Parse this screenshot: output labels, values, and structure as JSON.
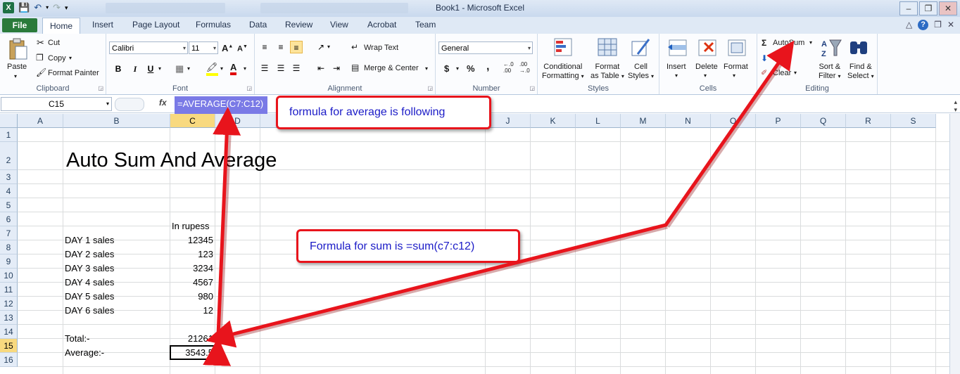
{
  "window": {
    "title": "Book1  -  Microsoft Excel"
  },
  "tabs": {
    "file": "File",
    "items": [
      "Home",
      "Insert",
      "Page Layout",
      "Formulas",
      "Data",
      "Review",
      "View",
      "Acrobat",
      "Team"
    ]
  },
  "ribbon": {
    "clipboard": {
      "label": "Clipboard",
      "paste": "Paste",
      "cut": "Cut",
      "copy": "Copy",
      "format_painter": "Format Painter"
    },
    "font": {
      "label": "Font",
      "font_name": "Calibri",
      "font_size": "11",
      "bold": "B",
      "italic": "I",
      "underline": "U"
    },
    "alignment": {
      "label": "Alignment",
      "wrap_text": "Wrap Text",
      "merge_center": "Merge & Center"
    },
    "number": {
      "label": "Number",
      "format": "General",
      "currency": "$",
      "percent": "%",
      "comma": ","
    },
    "styles": {
      "label": "Styles",
      "conditional_formatting": "Conditional",
      "conditional_formatting_2": "Formatting",
      "format_as_table": "Format",
      "format_as_table_2": "as Table",
      "cell_styles": "Cell",
      "cell_styles_2": "Styles"
    },
    "cells": {
      "label": "Cells",
      "insert": "Insert",
      "delete": "Delete",
      "format": "Format"
    },
    "editing": {
      "label": "Editing",
      "autosum": "AutoSum",
      "fill": "Fi",
      "clear": "Clear",
      "sort_filter": "Sort &",
      "sort_filter_2": "Filter",
      "find_select": "Find &",
      "find_select_2": "Select"
    }
  },
  "formula_bar": {
    "name_box": "C15",
    "fx": "fx",
    "formula": "=AVERAGE(C7:C12)"
  },
  "sheet": {
    "columns": [
      "A",
      "B",
      "C",
      "D",
      "J",
      "K",
      "L",
      "M",
      "N",
      "O",
      "P",
      "Q",
      "R",
      "S"
    ],
    "rows": [
      "1",
      "2",
      "3",
      "4",
      "5",
      "6",
      "7",
      "8",
      "9",
      "10",
      "11",
      "12",
      "13",
      "14",
      "15",
      "16"
    ],
    "selected_column": "C",
    "selected_row": "15",
    "title": "Auto Sum And Average",
    "header_c6": "In rupess",
    "labels": [
      "DAY 1 sales",
      "DAY 2 sales",
      "DAY 3 sales",
      "DAY 4 sales",
      "DAY 5 sales",
      "DAY 6 sales"
    ],
    "values": [
      "12345",
      "123",
      "3234",
      "4567",
      "980",
      "12"
    ],
    "total_label": "Total:-",
    "total_value": "21261",
    "average_label": "Average:-",
    "average_value": "3543.5"
  },
  "annotations": {
    "average_callout": "formula for average is following",
    "sum_callout": "Formula for sum is  =sum(c7:c12)",
    "arrow_color": "#e8141c"
  }
}
